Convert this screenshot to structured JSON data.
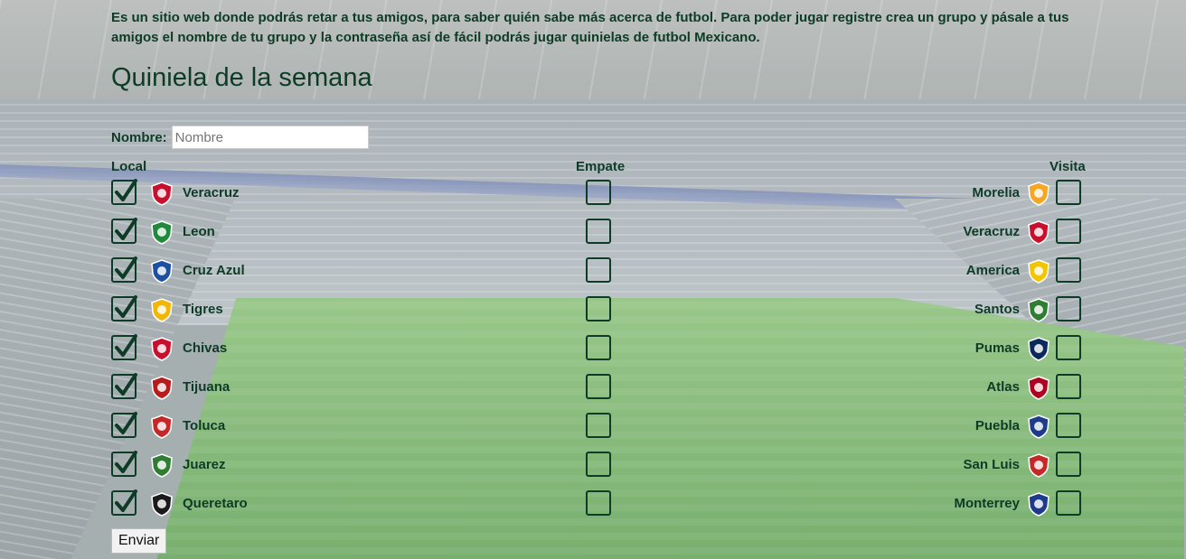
{
  "intro": "Es un sitio web donde podrás retar a tus amigos, para saber quién sabe más acerca de futbol. Para poder jugar registre crea un grupo y pásale a tus amigos el nombre de tu grupo y la contraseña así de fácil podrás jugar quinielas de futbol Mexicano.",
  "title": "Quiniela de la semana",
  "name_label": "Nombre:",
  "name_placeholder": "Nombre",
  "headers": {
    "local": "Local",
    "draw": "Empate",
    "visit": "Visita"
  },
  "matches": [
    {
      "local": "Veracruz",
      "visit": "Morelia",
      "local_checked": true,
      "draw_checked": false,
      "visit_checked": false,
      "local_color": "#c8102e",
      "visit_color": "#f5a623"
    },
    {
      "local": "Leon",
      "visit": "Veracruz",
      "local_checked": true,
      "draw_checked": false,
      "visit_checked": false,
      "local_color": "#1f8a3b",
      "visit_color": "#c8102e"
    },
    {
      "local": "Cruz Azul",
      "visit": "America",
      "local_checked": true,
      "draw_checked": false,
      "visit_checked": false,
      "local_color": "#1d4fa3",
      "visit_color": "#f2c500"
    },
    {
      "local": "Tigres",
      "visit": "Santos",
      "local_checked": true,
      "draw_checked": false,
      "visit_checked": false,
      "local_color": "#f2b705",
      "visit_color": "#2e7d32"
    },
    {
      "local": "Chivas",
      "visit": "Pumas",
      "local_checked": true,
      "draw_checked": false,
      "visit_checked": false,
      "local_color": "#c8102e",
      "visit_color": "#0b2a5b"
    },
    {
      "local": "Tijuana",
      "visit": "Atlas",
      "local_checked": true,
      "draw_checked": false,
      "visit_checked": false,
      "local_color": "#b71c1c",
      "visit_color": "#b00020"
    },
    {
      "local": "Toluca",
      "visit": "Puebla",
      "local_checked": true,
      "draw_checked": false,
      "visit_checked": false,
      "local_color": "#c62828",
      "visit_color": "#1e3a8a"
    },
    {
      "local": "Juarez",
      "visit": "San Luis",
      "local_checked": true,
      "draw_checked": false,
      "visit_checked": false,
      "local_color": "#2e7d32",
      "visit_color": "#c62828"
    },
    {
      "local": "Queretaro",
      "visit": "Monterrey",
      "local_checked": true,
      "draw_checked": false,
      "visit_checked": false,
      "local_color": "#1a1a1a",
      "visit_color": "#1e3a8a"
    }
  ],
  "submit_label": "Enviar"
}
